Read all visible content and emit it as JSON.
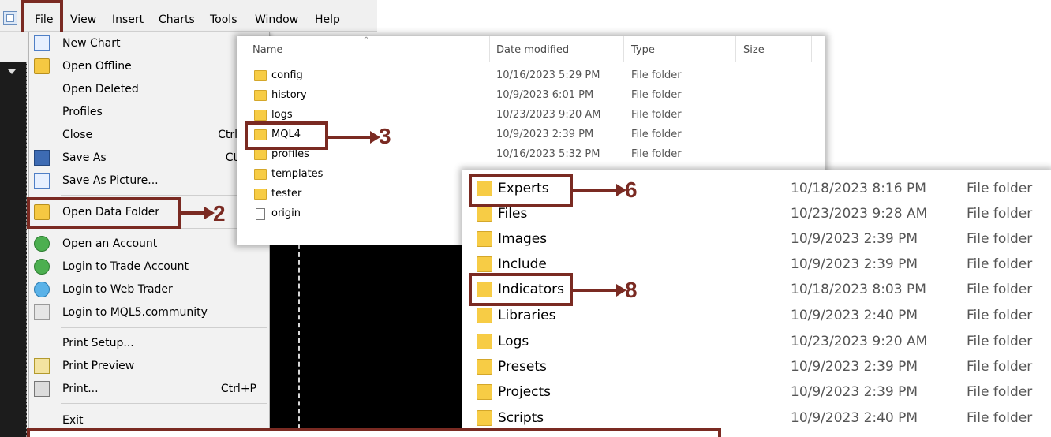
{
  "colors": {
    "annotation": "#7a2a22",
    "folder": "#f7cc45",
    "dark_bg": "#000000"
  },
  "menubar": {
    "app_icon": "window-icon",
    "items": [
      {
        "label": "File"
      },
      {
        "label": "View"
      },
      {
        "label": "Insert"
      },
      {
        "label": "Charts"
      },
      {
        "label": "Tools"
      },
      {
        "label": "Window"
      },
      {
        "label": "Help"
      }
    ]
  },
  "file_menu": {
    "items": [
      {
        "label": "New Chart",
        "shortcut": "",
        "icon": "new-chart-icon"
      },
      {
        "label": "Open Offline",
        "shortcut": "",
        "icon": "open-folder-icon"
      },
      {
        "label": "Open Deleted",
        "shortcut": "",
        "icon": ""
      },
      {
        "label": "Profiles",
        "shortcut": "",
        "icon": ""
      },
      {
        "label": "Close",
        "shortcut": "Ctrl",
        "icon": ""
      },
      {
        "label": "Save As",
        "shortcut": "Ct",
        "icon": "save-icon"
      },
      {
        "label": "Save As Picture...",
        "shortcut": "",
        "icon": "picture-icon"
      },
      {
        "label": "Open Data Folder",
        "shortcut": "",
        "icon": "folder-icon"
      },
      {
        "label": "Open an Account",
        "shortcut": "",
        "icon": "account-add-icon"
      },
      {
        "label": "Login to Trade Account",
        "shortcut": "",
        "icon": "login-icon"
      },
      {
        "label": "Login to Web Trader",
        "shortcut": "",
        "icon": "web-icon"
      },
      {
        "label": "Login to MQL5.community",
        "shortcut": "",
        "icon": "community-icon"
      },
      {
        "label": "Print Setup...",
        "shortcut": "",
        "icon": ""
      },
      {
        "label": "Print Preview",
        "shortcut": "",
        "icon": "print-preview-icon"
      },
      {
        "label": "Print...",
        "shortcut": "Ctrl+P",
        "icon": "printer-icon"
      },
      {
        "label": "Exit",
        "shortcut": "",
        "icon": ""
      }
    ]
  },
  "explorer1": {
    "columns": {
      "name": "Name",
      "date": "Date modified",
      "type": "Type",
      "size": "Size"
    },
    "rows": [
      {
        "name": "config",
        "date": "10/16/2023 5:29 PM",
        "type": "File folder",
        "kind": "folder"
      },
      {
        "name": "history",
        "date": "10/9/2023 6:01 PM",
        "type": "File folder",
        "kind": "folder"
      },
      {
        "name": "logs",
        "date": "10/23/2023 9:20 AM",
        "type": "File folder",
        "kind": "folder"
      },
      {
        "name": "MQL4",
        "date": "10/9/2023 2:39 PM",
        "type": "File folder",
        "kind": "folder"
      },
      {
        "name": "profiles",
        "date": "10/16/2023 5:32 PM",
        "type": "File folder",
        "kind": "folder"
      },
      {
        "name": "templates",
        "date": "",
        "type": "",
        "kind": "folder"
      },
      {
        "name": "tester",
        "date": "",
        "type": "",
        "kind": "folder"
      },
      {
        "name": "origin",
        "date": "",
        "type": "",
        "kind": "file"
      }
    ]
  },
  "explorer2": {
    "rows": [
      {
        "name": "Experts",
        "date": "10/18/2023 8:16 PM",
        "type": "File folder"
      },
      {
        "name": "Files",
        "date": "10/23/2023 9:28 AM",
        "type": "File folder"
      },
      {
        "name": "Images",
        "date": "10/9/2023 2:39 PM",
        "type": "File folder"
      },
      {
        "name": "Include",
        "date": "10/9/2023 2:39 PM",
        "type": "File folder"
      },
      {
        "name": "Indicators",
        "date": "10/18/2023 8:03 PM",
        "type": "File folder"
      },
      {
        "name": "Libraries",
        "date": "10/9/2023 2:40 PM",
        "type": "File folder"
      },
      {
        "name": "Logs",
        "date": "10/23/2023 9:20 AM",
        "type": "File folder"
      },
      {
        "name": "Presets",
        "date": "10/9/2023 2:39 PM",
        "type": "File folder"
      },
      {
        "name": "Projects",
        "date": "10/9/2023 2:39 PM",
        "type": "File folder"
      },
      {
        "name": "Scripts",
        "date": "10/9/2023 2:40 PM",
        "type": "File folder"
      }
    ]
  },
  "annotations": {
    "step2": "2",
    "step3": "3",
    "step6": "6",
    "step8": "8"
  }
}
